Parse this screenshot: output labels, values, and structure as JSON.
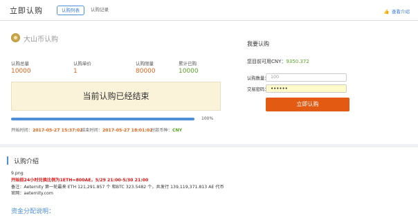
{
  "header": {
    "app_title": "立即认购",
    "tabs": [
      {
        "label": "认购列表",
        "active": true
      },
      {
        "label": "认购记录",
        "active": false
      }
    ],
    "help_label": "查看介绍",
    "help_icon": "thumbs-up-icon"
  },
  "coin": {
    "title": "大山币认购",
    "icon": "coin-icon",
    "stats": [
      {
        "label": "认购总量",
        "value": "10000"
      },
      {
        "label": "认购单价",
        "value": "1"
      },
      {
        "label": "认购限量",
        "value": "80000"
      },
      {
        "label": "累计已购",
        "value": "10000"
      }
    ],
    "status_message": "当前认购已经结束",
    "progress_fraction": 1.0,
    "progress_label": "100%",
    "start_label": "开始时间：",
    "start_value": "2017-05-27 15:37:02",
    "end_label": "结束时间：",
    "end_value": "2017-05-27 18:01:02",
    "currency_label": "付款币种：",
    "currency_value": "CNY"
  },
  "purchase": {
    "title": "我要认购",
    "available_label": "您目前可用CNY：",
    "available_value": "9350.372",
    "quantity_label": "认购数量：",
    "quantity_value": "100",
    "password_label": "交易密码：",
    "password_value": "••••••",
    "submit_label": "立即认购"
  },
  "intro": {
    "title": "认购介绍",
    "lines": [
      "9.png",
      "开始前24小时兑换比例为1ETH=800AE，5/29 21:00-5/30 21:00",
      "备注：Aeternity 第一轮最来  ETH 121,291.857 个  和BTC 323.5482 个，共发行 139,119,371.813  AE 代币",
      "官网：aeternity.com"
    ],
    "fund_title": "资金分配说明："
  },
  "colors": {
    "accent": "#4f8fd8",
    "orange": "#e0641a",
    "green": "#5aa224",
    "button": "#e35a12",
    "alert_red": "#e01414"
  }
}
